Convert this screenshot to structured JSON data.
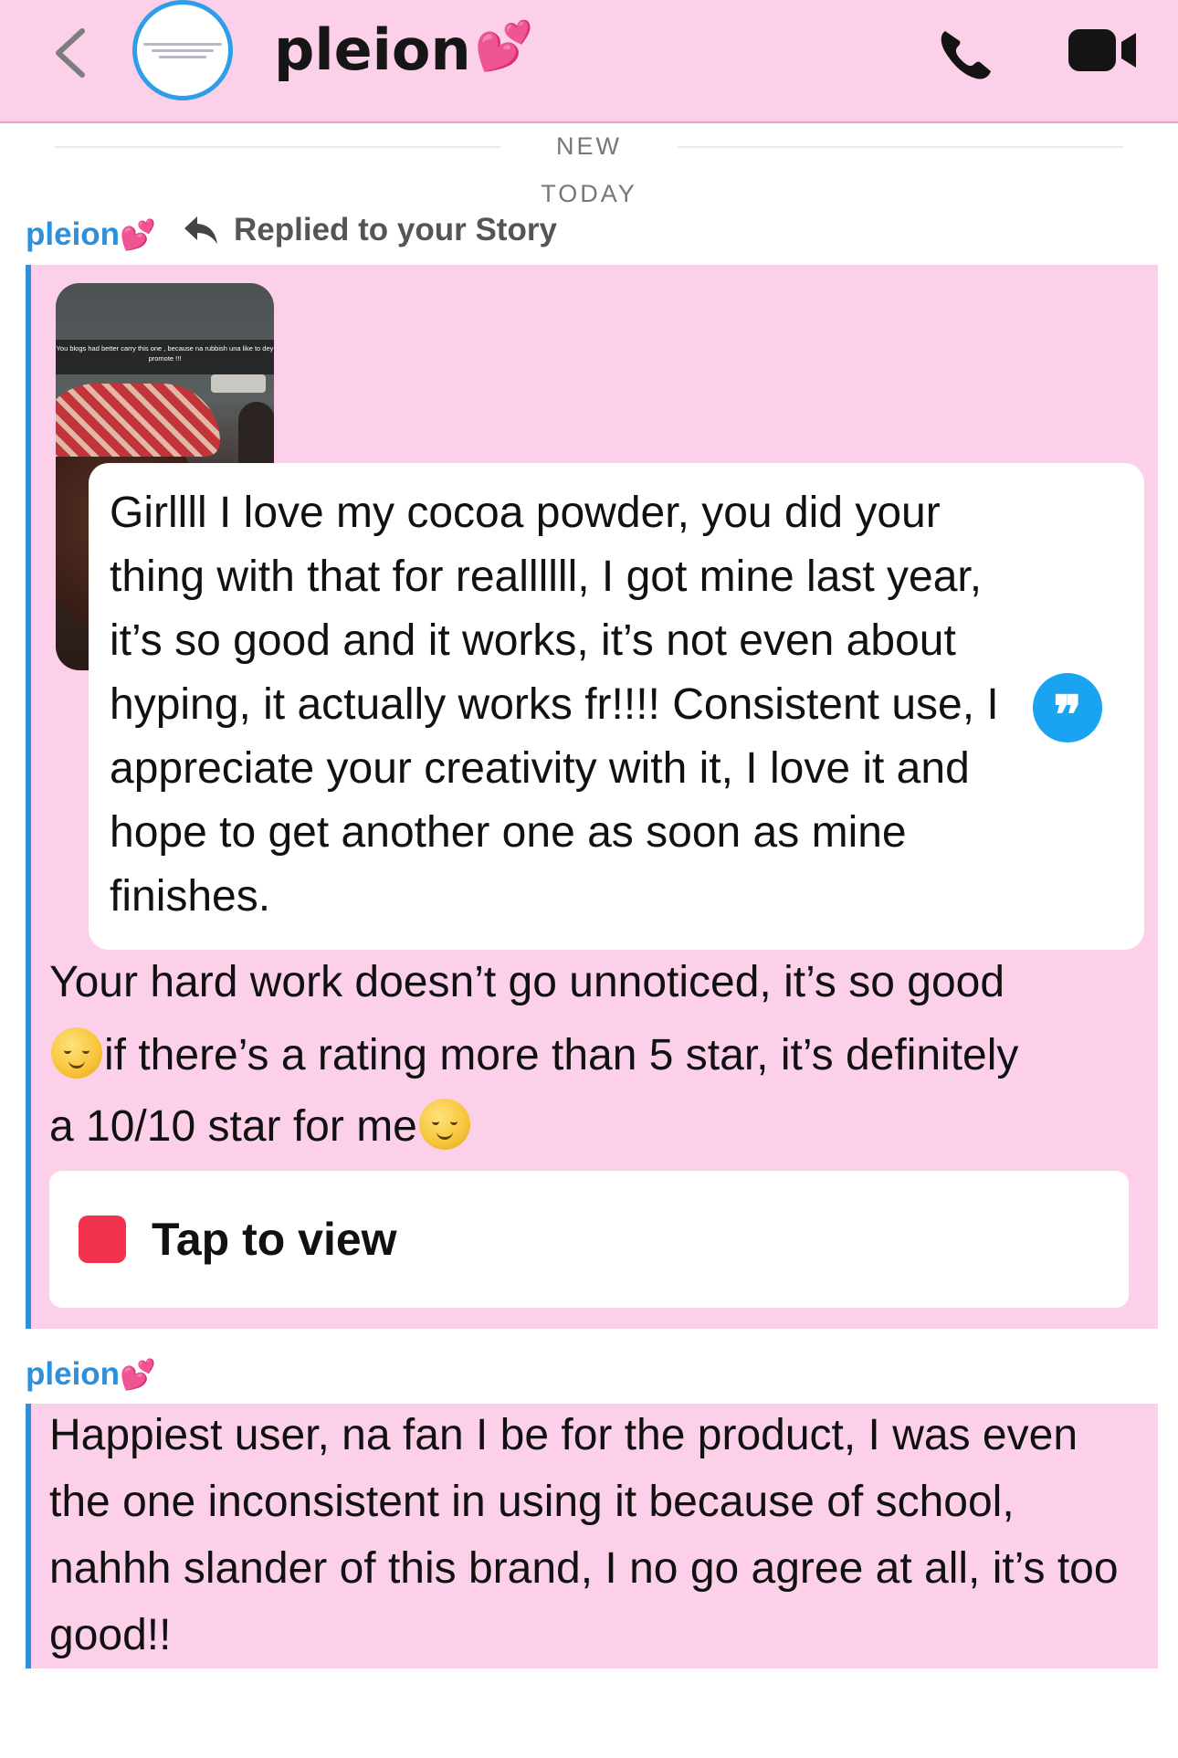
{
  "header": {
    "contact_name": "pleion",
    "contact_emoji": "💕",
    "icons": {
      "back": "chevron-left-icon",
      "call": "phone-icon",
      "video": "video-camera-icon"
    }
  },
  "separators": {
    "new_label": "NEW",
    "today_label": "TODAY"
  },
  "messages": [
    {
      "sender": "pleion",
      "sender_emoji": "💕",
      "reply_meta": "Replied to your Story",
      "story_caption": "You blogs had better carry this one , because na rubbish una like to dey promote !!!",
      "quote_text": "Girllll I love my cocoa powder, you did your thing with that for reallllll, I got mine last year, it’s so good and it works, it’s not even about hyping, it actually works fr!!!! Consistent use, I appreciate your creativity with it, I love it and hope to get another one as soon as mine finishes.",
      "body_line1": "Your hard work doesn’t go unnoticed, it’s so good",
      "body_line2": "if there’s a rating more than 5 star, it’s definitely",
      "body_line3": "a 10/10 star for me",
      "tap_label": "Tap to view"
    },
    {
      "sender": "pleion",
      "sender_emoji": "💕",
      "text": "Happiest user, na fan I be for the product, I was even the one inconsistent in using it because of school, nahhh slander of this brand, I no go agree at all, it’s too good!!"
    }
  ],
  "colors": {
    "header_bg": "#fdd0ea",
    "accent_blue": "#2f8fd8",
    "tap_red": "#f2334d"
  }
}
